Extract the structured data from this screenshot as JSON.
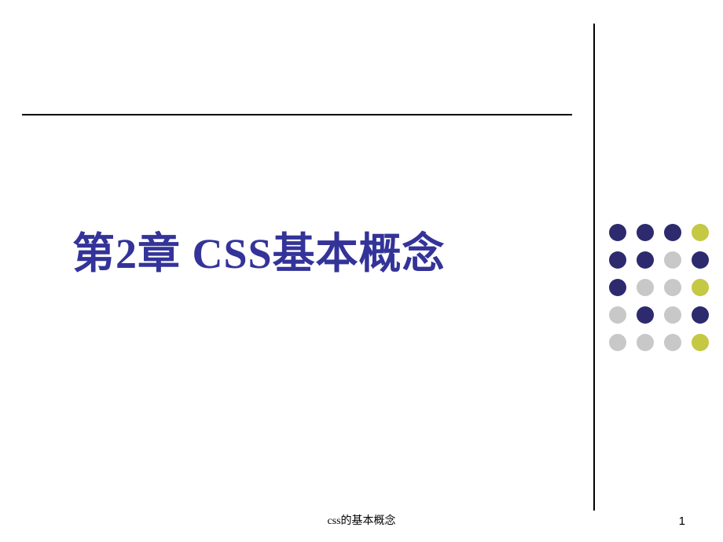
{
  "slide": {
    "title": "第2章  CSS基本概念",
    "footer": "css的基本概念",
    "page_number": "1"
  },
  "colors": {
    "title_color": "#333399",
    "dot_dark": "#2d2a6e",
    "dot_yellow": "#c4c843",
    "dot_gray": "#c8c8c8"
  },
  "decoration": {
    "dots_pattern": [
      [
        "dark",
        "dark",
        "dark",
        "yellow"
      ],
      [
        "dark",
        "dark",
        "gray",
        "dark"
      ],
      [
        "dark",
        "gray",
        "gray",
        "yellow"
      ],
      [
        "gray",
        "dark",
        "gray",
        "dark"
      ],
      [
        "gray",
        "gray",
        "gray",
        "yellow"
      ]
    ]
  }
}
